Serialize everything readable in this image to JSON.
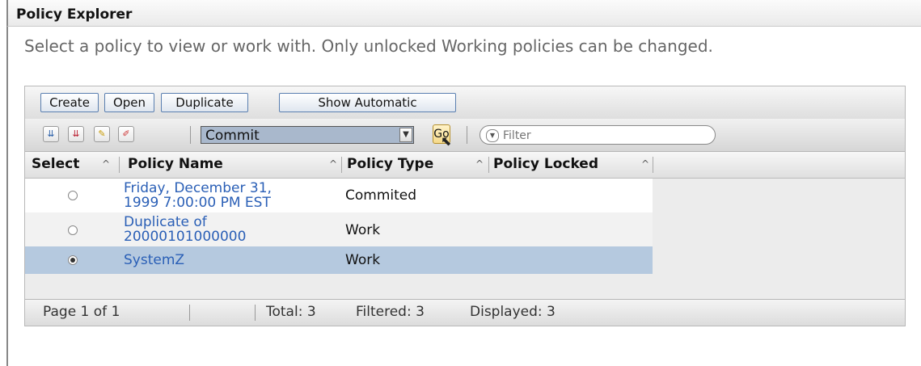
{
  "window": {
    "title": "Policy Explorer"
  },
  "description": "Select a policy to view or work with. Only unlocked Working policies can be changed.",
  "toolbar": {
    "create_label": "Create",
    "open_label": "Open",
    "duplicate_label": "Duplicate",
    "show_automatic_label": "Show Automatic"
  },
  "actions": {
    "selected": "Commit",
    "go_label": "Go",
    "icons": [
      "select-all-icon",
      "deselect-all-icon",
      "edit-icon",
      "clear-icon"
    ]
  },
  "filter": {
    "placeholder": "Filter"
  },
  "table": {
    "columns": [
      "Select",
      "Policy Name",
      "Policy Type",
      "Policy Locked"
    ],
    "rows": [
      {
        "name_line1": "Friday, December 31,",
        "name_line2": "1999 7:00:00 PM EST",
        "type": "Commited",
        "locked": "",
        "selected": false
      },
      {
        "name_line1": "Duplicate of",
        "name_line2": "20000101000000",
        "type": "Work",
        "locked": "",
        "selected": false
      },
      {
        "name_line1": "SystemZ",
        "name_line2": "",
        "type": "Work",
        "locked": "",
        "selected": true
      }
    ]
  },
  "footer": {
    "page": "Page 1 of 1",
    "total": "Total: 3",
    "filtered": "Filtered: 3",
    "displayed": "Displayed: 3"
  },
  "colors": {
    "link": "#2a5fb6",
    "selected_row": "#b5c9df",
    "button_border": "#5a7fb0"
  }
}
